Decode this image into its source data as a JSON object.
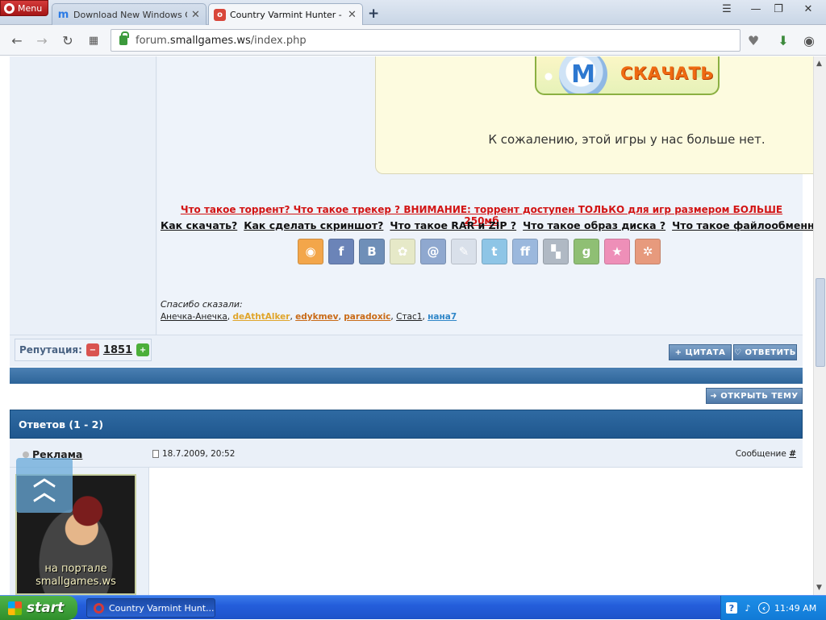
{
  "browser": {
    "menu_label": "Menu",
    "tabs": [
      {
        "title": "Download New Windows Gam",
        "favicon": "m",
        "state": "inactive"
      },
      {
        "title": "Country Varmint Hunter - Фор",
        "favicon": "o",
        "state": "active"
      }
    ],
    "close_glyph": "✕",
    "new_tab_glyph": "+",
    "address": {
      "domain": "forum.",
      "host": "smallgames.ws",
      "path": "/index.php"
    }
  },
  "post": {
    "download_label": "СКАЧАТЬ",
    "download_logo": "M",
    "no_game_text": "К сожалению, этой игры у нас больше нет.",
    "torrent_warning": "Что такое торрент? Что такое трекер ? ВНИМАНИЕ: торрент доступен ТОЛЬКО для игр размером БОЛЬШЕ 250мб",
    "faq_links": [
      "Как скачать?",
      "Как сделать скриншот?",
      "Что такое RAR и ZIP ?",
      "Что такое образ диска ?",
      "Что такое файлообменники?"
    ],
    "social": [
      {
        "name": "rss",
        "glyph": "◉",
        "color": "#f3a64a"
      },
      {
        "name": "facebook",
        "glyph": "f",
        "color": "#6b84b8"
      },
      {
        "name": "vkontakte",
        "glyph": "B",
        "color": "#6f8fb8"
      },
      {
        "name": "odnoklassniki",
        "glyph": "✿",
        "color": "#e6e9c8"
      },
      {
        "name": "mailru",
        "glyph": "@",
        "color": "#8fa8cf"
      },
      {
        "name": "livejournal",
        "glyph": "✎",
        "color": "#d9e0ea"
      },
      {
        "name": "twitter",
        "glyph": "t",
        "color": "#8ec5e6"
      },
      {
        "name": "friendfeed",
        "glyph": "ff",
        "color": "#9bb8dd"
      },
      {
        "name": "delicious",
        "glyph": "▚",
        "color": "#b0b9c4"
      },
      {
        "name": "google",
        "glyph": "g",
        "color": "#8fbf74"
      },
      {
        "name": "favorites",
        "glyph": "★",
        "color": "#ee8fb8"
      },
      {
        "name": "misc",
        "glyph": "✲",
        "color": "#e79a7d"
      }
    ],
    "thanks_label": "Спасибо сказали:",
    "thanks": [
      {
        "name": "Анечка-Анечка",
        "color": "#222",
        "bold": false
      },
      {
        "name": "deAthtAlker",
        "color": "#e0a52b",
        "bold": true
      },
      {
        "name": "edykmev",
        "color": "#c96a16",
        "bold": true
      },
      {
        "name": "paradoxic",
        "color": "#c96a16",
        "bold": true
      },
      {
        "name": "Стас1",
        "color": "#222",
        "bold": false
      },
      {
        "name": "нана7",
        "color": "#2f86c8",
        "bold": true
      }
    ],
    "separator": ", "
  },
  "reputation": {
    "label": "Репутация:",
    "value": "1851",
    "down_glyph": "−",
    "up_glyph": "+"
  },
  "buttons": {
    "quote": "ЦИТАТА",
    "reply": "ОТВЕТИТЬ",
    "open_topic": "ОТКРЫТЬ ТЕМУ"
  },
  "replies": {
    "header": "Ответов (1 - 2)",
    "author": "Реклама",
    "date": "18.7.2009, 20:52",
    "message_label": "Сообщение",
    "message_hash": "#",
    "avatar_caption_1": "на портале",
    "avatar_caption_2": "smallgames.ws"
  },
  "taskbar": {
    "start": "start",
    "item": "Country Varmint Hunt...",
    "clock": "11:49 AM"
  }
}
